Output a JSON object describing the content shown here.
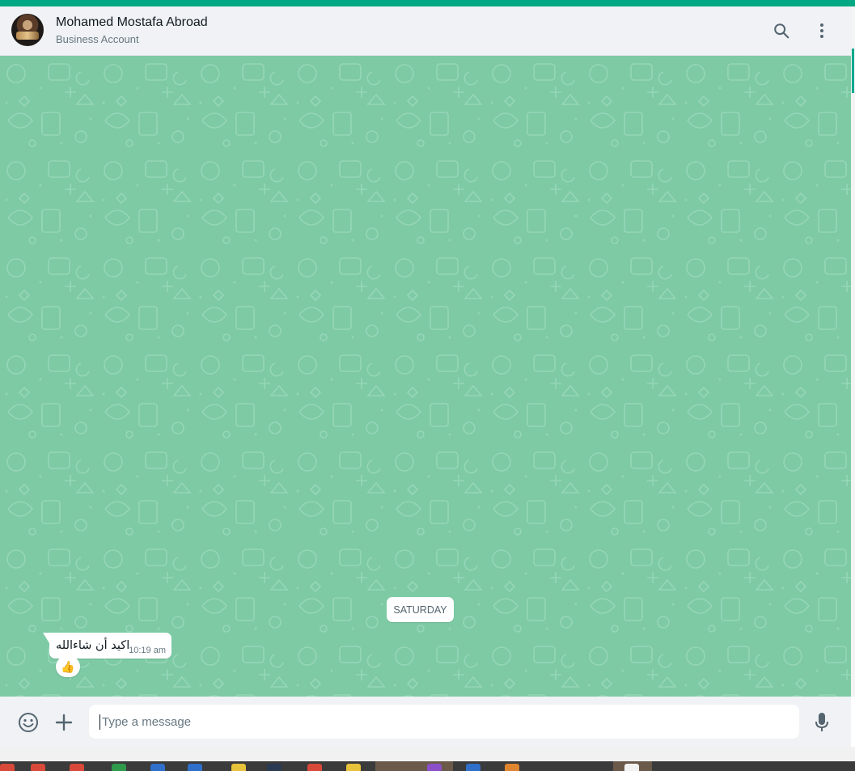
{
  "header": {
    "contact_name": "Mohamed Mostafa Abroad",
    "contact_subtitle": "Business Account",
    "search_icon": "search-icon",
    "menu_icon": "vertical-dots-icon"
  },
  "chat": {
    "wallpaper_color": "#7dcaa5",
    "date_divider": "SATURDAY",
    "messages": [
      {
        "direction": "incoming",
        "text": "اكيد أن شاءالله",
        "time": "10:19 am",
        "reaction": "👍"
      }
    ]
  },
  "composer": {
    "emoji_icon": "emoji-icon",
    "attach_icon": "plus-icon",
    "placeholder": "Type a message",
    "mic_icon": "microphone-icon"
  },
  "colors": {
    "accent": "#00a884",
    "header_bg": "#f0f2f5",
    "bubble_bg": "#ffffff"
  }
}
